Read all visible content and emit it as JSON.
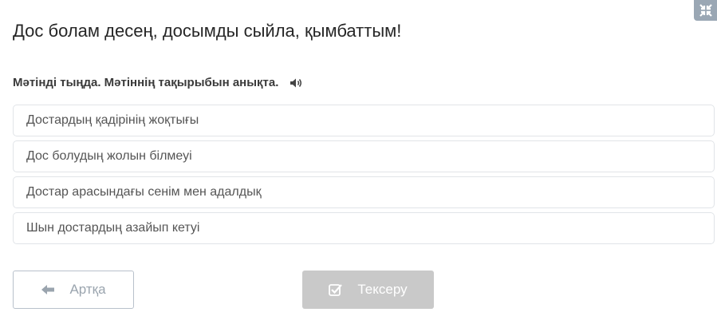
{
  "title": "Дос болам десең, досымды сыйла, қымбаттым!",
  "question": {
    "text": "Мәтінді тыңда. Мәтіннің тақырыбын анықта.",
    "audio_icon": "speaker-icon"
  },
  "options": [
    {
      "label": "Достардың қадірінің жоқтығы"
    },
    {
      "label": "Дос болудың жолын білмеуі"
    },
    {
      "label": "Достар арасындағы сенім мен адалдық"
    },
    {
      "label": "Шын достардың азайып кетуі"
    }
  ],
  "buttons": {
    "back_label": "Артқа",
    "check_label": "Тексеру"
  },
  "colors": {
    "corner_button": "#9aa7b4",
    "check_button_disabled": "#c9c9c9",
    "back_border": "#b8c1cb"
  }
}
